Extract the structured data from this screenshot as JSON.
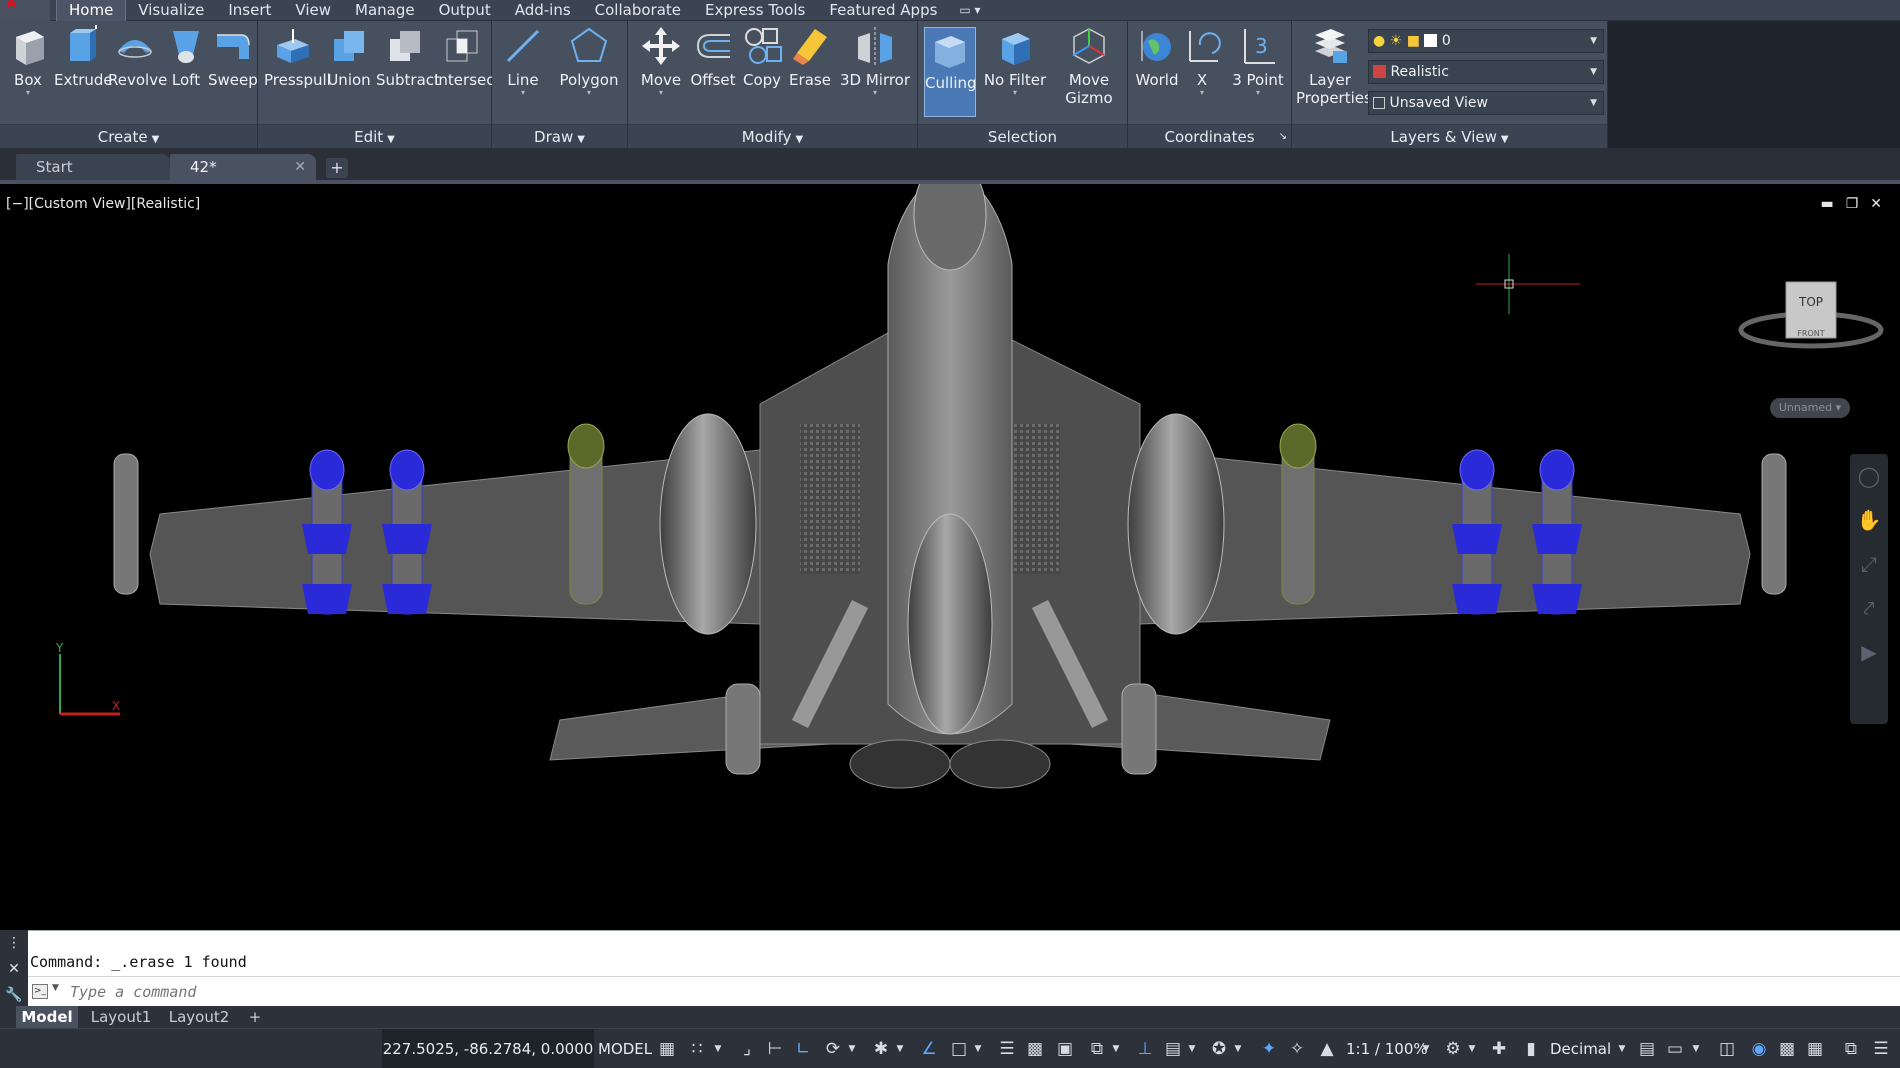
{
  "ribbon_tabs": [
    "Home",
    "Visualize",
    "Insert",
    "View",
    "Manage",
    "Output",
    "Add-ins",
    "Collaborate",
    "Express Tools",
    "Featured Apps"
  ],
  "panels": {
    "create": {
      "title": "Create",
      "tools": [
        "Box",
        "Extrude",
        "Revolve",
        "Loft",
        "Sweep"
      ]
    },
    "edit": {
      "title": "Edit",
      "tools": [
        "Presspull",
        "Union",
        "Subtract",
        "Intersect"
      ]
    },
    "draw": {
      "title": "Draw",
      "tools": [
        "Line",
        "Polygon"
      ]
    },
    "modify": {
      "title": "Modify",
      "tools": [
        "Move",
        "Offset",
        "Copy",
        "Erase",
        "3D Mirror"
      ]
    },
    "selection": {
      "title": "Selection",
      "tools": [
        "Culling",
        "No Filter",
        "Move Gizmo"
      ]
    },
    "coordinates": {
      "title": "Coordinates",
      "tools": [
        "World",
        "X",
        "3 Point"
      ]
    },
    "layers_view": {
      "title": "Layers & View",
      "tool": "Layer Properties",
      "layer_value": "0",
      "visual_style": "Realistic",
      "view": "Unsaved View"
    }
  },
  "file_tabs": {
    "start": "Start",
    "document": "42*"
  },
  "viewport": {
    "label": "[−][Custom View][Realistic]",
    "viewcube_top": "TOP",
    "viewcube_front": "FRONT",
    "ucs_name": "Unnamed"
  },
  "command_line": {
    "history": "Command: _.erase 1 found",
    "placeholder": "Type a command"
  },
  "layout_tabs": [
    "Model",
    "Layout1",
    "Layout2"
  ],
  "status_bar": {
    "coordinates": "227.5025, -86.2784, 0.0000",
    "space": "MODEL",
    "scale": "1:1 / 100%",
    "units": "Decimal"
  },
  "colors": {
    "ribbon_bg": "#46505f",
    "viewport_bg": "#000000",
    "accent": "#4b79b6",
    "model_gray": "#8a8a8a",
    "missile_blue": "#2a2ad8",
    "missile_olive": "#7b8a3a"
  }
}
